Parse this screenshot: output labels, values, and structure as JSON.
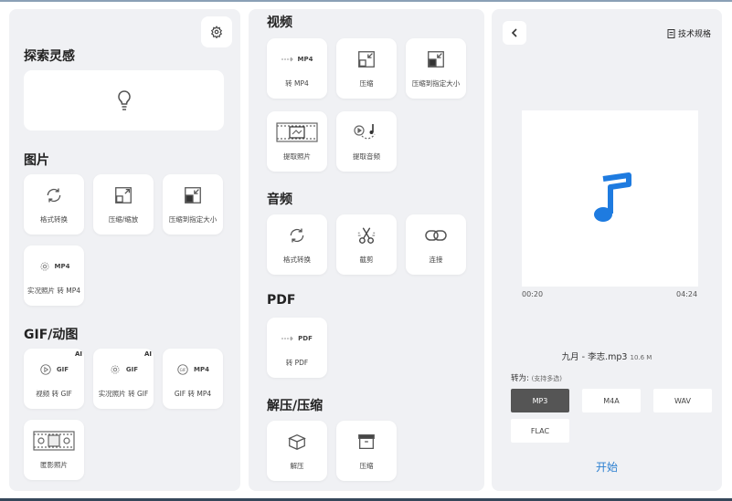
{
  "left": {
    "inspire_title": "探索灵感",
    "images_title": "图片",
    "gif_title": "GIF/动图",
    "image_tools": [
      {
        "label": "格式转换",
        "icon": "refresh-icon"
      },
      {
        "label": "压缩/缩放",
        "icon": "resize-icon"
      },
      {
        "label": "压缩到指定大小",
        "icon": "compress-size-icon"
      },
      {
        "label": "实况照片 转 MP4",
        "icon": "live-photo-to-mp4-icon",
        "tag": "MP4"
      }
    ],
    "gif_tools": [
      {
        "label": "视频 转 GIF",
        "icon": "video-to-gif-icon",
        "tag": "GIF",
        "ai": "AI"
      },
      {
        "label": "实况照片 转 GIF",
        "icon": "live-to-gif-icon",
        "tag": "GIF",
        "ai": "AI"
      },
      {
        "label": "GIF 转 MP4",
        "icon": "gif-to-mp4-icon",
        "tag": "MP4"
      },
      {
        "label": "匿影照片",
        "icon": "photo-strip-icon"
      }
    ]
  },
  "middle": {
    "video_title": "视频",
    "audio_title": "音频",
    "pdf_title": "PDF",
    "archive_title": "解压/压缩",
    "video_tools": [
      {
        "label": "转 MP4",
        "icon": "to-mp4-icon",
        "tag": "MP4"
      },
      {
        "label": "压缩",
        "icon": "compress-icon"
      },
      {
        "label": "压缩到指定大小",
        "icon": "compress-size-icon"
      },
      {
        "label": "提取照片",
        "icon": "film-frame-icon"
      },
      {
        "label": "提取音频",
        "icon": "extract-audio-icon"
      }
    ],
    "audio_tools": [
      {
        "label": "格式转换",
        "icon": "refresh-icon"
      },
      {
        "label": "截剪",
        "icon": "scissors-icon"
      },
      {
        "label": "连接",
        "icon": "link-icon"
      }
    ],
    "pdf_tools": [
      {
        "label": "转 PDF",
        "icon": "to-pdf-icon",
        "tag": "PDF"
      }
    ],
    "archive_tools": [
      {
        "label": "解压",
        "icon": "open-box-icon"
      },
      {
        "label": "压缩",
        "icon": "archive-box-icon"
      }
    ]
  },
  "right": {
    "spec_label": "技术规格",
    "time_start": "00:20",
    "time_end": "04:24",
    "file_name": "九月 - 李志.mp3",
    "file_size": "10.6 M",
    "convert_label": "转为:",
    "convert_hint": "(支持多选)",
    "formats": [
      {
        "label": "MP3",
        "selected": true
      },
      {
        "label": "M4A",
        "selected": false
      },
      {
        "label": "WAV",
        "selected": false
      },
      {
        "label": "FLAC",
        "selected": false
      }
    ],
    "start_label": "开始",
    "accent_color": "#1e7be0"
  }
}
